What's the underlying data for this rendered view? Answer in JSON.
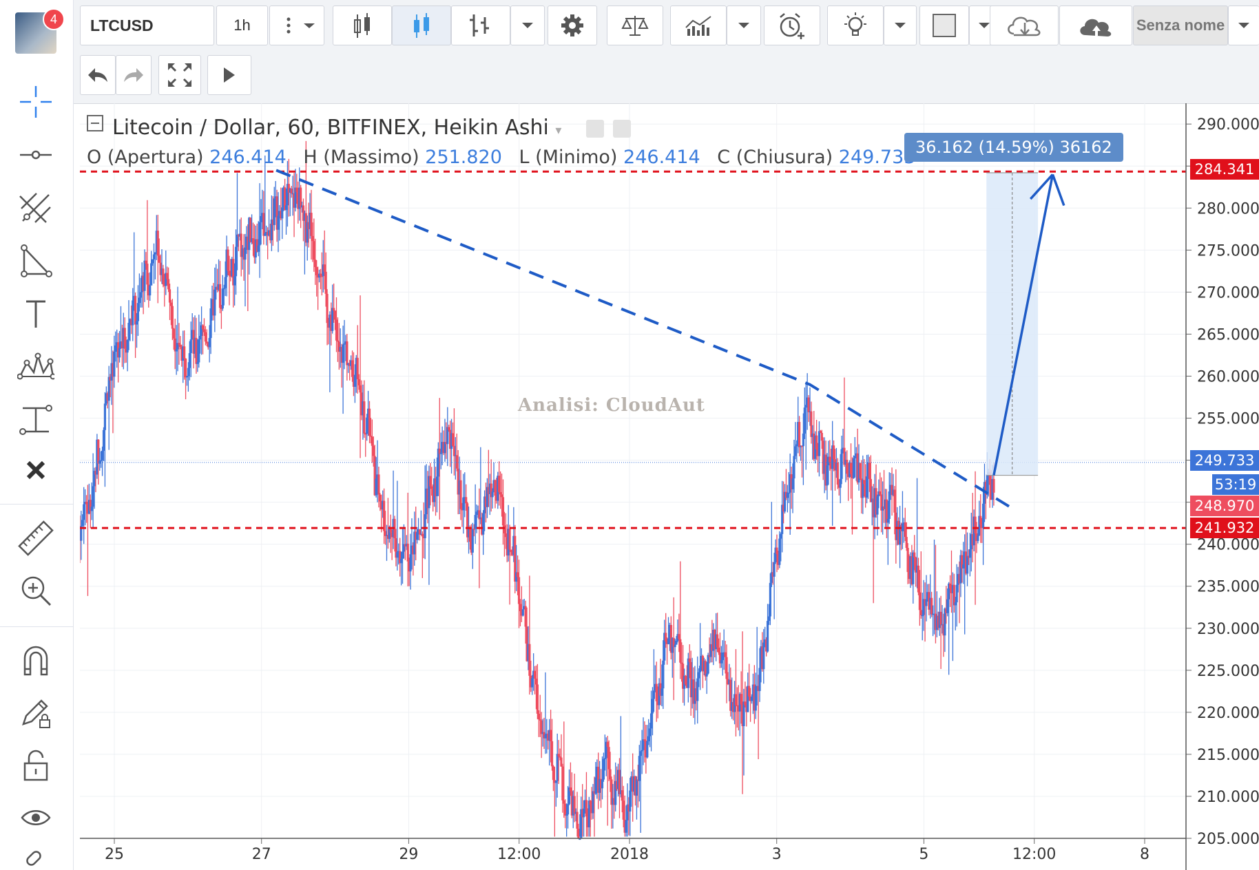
{
  "toolbar": {
    "symbol": "LTCUSD",
    "interval": "1h",
    "layout_name": "Senza nome",
    "notifications": "4"
  },
  "legend": {
    "title": "Litecoin / Dollar, 60, BITFINEX, Heikin Ashi",
    "open_label": "O (Apertura)",
    "open": "246.414",
    "high_label": "H (Massimo)",
    "high": "251.820",
    "low_label": "L (Minimo)",
    "low": "246.414",
    "close_label": "C (Chiusura)",
    "close": "249.733"
  },
  "watermark": "Analisi: CloudAut",
  "measure_label": "36.162 (14.59%) 36162",
  "price_labels": {
    "top_line": "284.341",
    "last": "249.733",
    "countdown": "53:19",
    "prev": "248.970",
    "support": "241.932"
  },
  "colors": {
    "up": "#3c74d8",
    "down": "#ee4d5f",
    "resistance": "#e0101b",
    "trend": "#1e5bc6",
    "measure_fill": "#dbe9f9"
  },
  "chart_data": {
    "type": "candlestick",
    "title": "Litecoin / Dollar, 60, BITFINEX, Heikin Ashi",
    "ylim": [
      205,
      291
    ],
    "y_ticks": [
      205,
      210,
      215,
      220,
      225,
      230,
      235,
      240,
      245,
      250,
      255,
      260,
      265,
      270,
      275,
      280,
      285,
      290
    ],
    "y_tick_labels": [
      "205.000",
      "210.000",
      "215.000",
      "220.000",
      "225.000",
      "230.000",
      "235.000",
      "240.000",
      "",
      "",
      "255.000",
      "260.000",
      "265.000",
      "270.000",
      "275.000",
      "280.000",
      "",
      "290.000"
    ],
    "x_ticks": [
      "25",
      "27",
      "29",
      "12:00",
      "2018",
      "3",
      "5",
      "12:00",
      "8"
    ],
    "x_tick_pos": [
      0.5,
      2.5,
      4.5,
      6.0,
      7.5,
      9.5,
      11.5,
      13.0,
      14.5
    ],
    "xlim": [
      0,
      14.5
    ],
    "series": [
      {
        "x": 0.0,
        "y": 240
      },
      {
        "x": 0.3,
        "y": 246
      },
      {
        "x": 0.6,
        "y": 262
      },
      {
        "x": 0.9,
        "y": 268
      },
      {
        "x": 1.2,
        "y": 276
      },
      {
        "x": 1.5,
        "y": 262
      },
      {
        "x": 1.8,
        "y": 264
      },
      {
        "x": 2.1,
        "y": 272
      },
      {
        "x": 2.4,
        "y": 276
      },
      {
        "x": 2.7,
        "y": 278
      },
      {
        "x": 3.0,
        "y": 282
      },
      {
        "x": 3.3,
        "y": 276
      },
      {
        "x": 3.6,
        "y": 264
      },
      {
        "x": 3.9,
        "y": 260
      },
      {
        "x": 4.2,
        "y": 244
      },
      {
        "x": 4.5,
        "y": 238
      },
      {
        "x": 4.8,
        "y": 244
      },
      {
        "x": 5.1,
        "y": 254
      },
      {
        "x": 5.4,
        "y": 240
      },
      {
        "x": 5.7,
        "y": 248
      },
      {
        "x": 6.0,
        "y": 238
      },
      {
        "x": 6.3,
        "y": 220
      },
      {
        "x": 6.6,
        "y": 212
      },
      {
        "x": 6.9,
        "y": 206
      },
      {
        "x": 7.2,
        "y": 214
      },
      {
        "x": 7.5,
        "y": 208
      },
      {
        "x": 7.8,
        "y": 218
      },
      {
        "x": 8.1,
        "y": 230
      },
      {
        "x": 8.4,
        "y": 222
      },
      {
        "x": 8.7,
        "y": 228
      },
      {
        "x": 9.0,
        "y": 220
      },
      {
        "x": 9.3,
        "y": 224
      },
      {
        "x": 9.6,
        "y": 244
      },
      {
        "x": 9.9,
        "y": 256
      },
      {
        "x": 10.2,
        "y": 249
      },
      {
        "x": 10.5,
        "y": 250
      },
      {
        "x": 10.8,
        "y": 246
      },
      {
        "x": 11.1,
        "y": 244
      },
      {
        "x": 11.4,
        "y": 236
      },
      {
        "x": 11.7,
        "y": 230
      },
      {
        "x": 12.0,
        "y": 236
      },
      {
        "x": 12.3,
        "y": 244
      },
      {
        "x": 12.45,
        "y": 248.5
      }
    ],
    "resistance_price": 284.341,
    "support_price": 241.932,
    "last_price": 249.733,
    "trendline": [
      {
        "x": 2.7,
        "y": 284.5
      },
      {
        "x": 9.95,
        "y": 259
      },
      {
        "x": 12.75,
        "y": 244
      }
    ],
    "measure": {
      "x0": 12.35,
      "x1": 13.05,
      "p0": 248.2,
      "p1": 284.2
    },
    "arrow": [
      {
        "x": 12.45,
        "y": 248.2
      },
      {
        "x": 13.25,
        "y": 284
      }
    ]
  }
}
